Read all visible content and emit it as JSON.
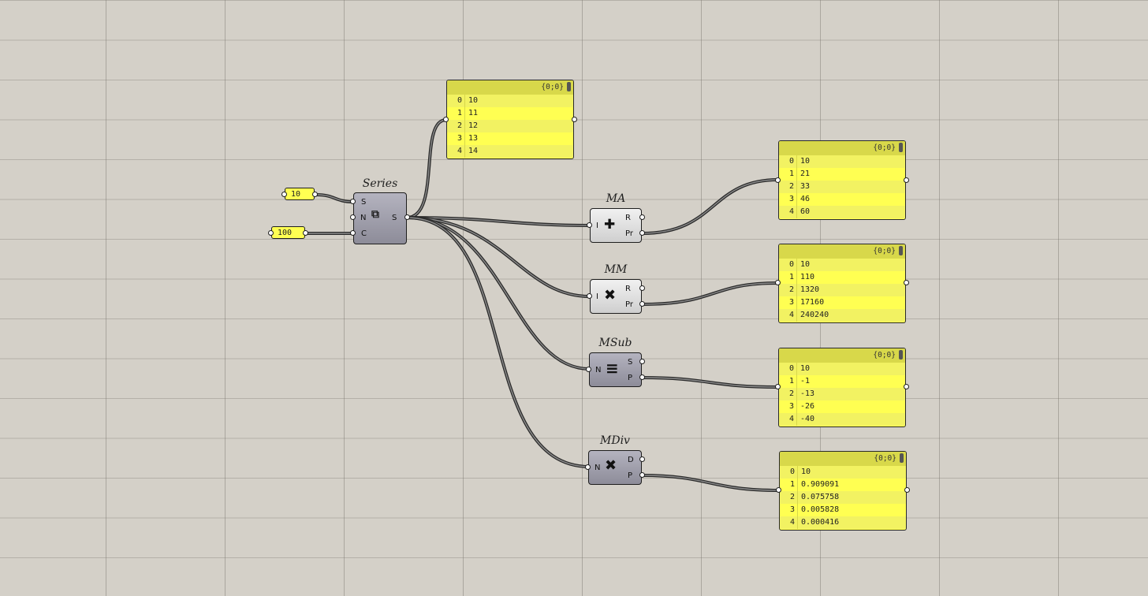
{
  "sliders": [
    {
      "id": "slider-start",
      "value": "10"
    },
    {
      "id": "slider-count",
      "value": "100"
    }
  ],
  "components": {
    "series": {
      "title": "Series",
      "inputs": [
        "S",
        "N",
        "C"
      ],
      "outputs": [
        "S"
      ],
      "icon": "series-icon"
    },
    "ma": {
      "title": "MA",
      "inputs": [
        "I"
      ],
      "outputs": [
        "R",
        "Pr"
      ],
      "icon": "mass-addition-icon"
    },
    "mm": {
      "title": "MM",
      "inputs": [
        "I"
      ],
      "outputs": [
        "R",
        "Pr"
      ],
      "icon": "mass-multiplication-icon"
    },
    "msub": {
      "title": "MSub",
      "inputs": [
        "N"
      ],
      "outputs": [
        "S",
        "P"
      ],
      "icon": "mass-subtraction-icon"
    },
    "mdiv": {
      "title": "MDiv",
      "inputs": [
        "N"
      ],
      "outputs": [
        "D",
        "P"
      ],
      "icon": "mass-division-icon"
    }
  },
  "panels": [
    {
      "id": "panel-series",
      "path": "{0;0}",
      "rows": [
        {
          "i": "0",
          "v": "10"
        },
        {
          "i": "1",
          "v": "11"
        },
        {
          "i": "2",
          "v": "12"
        },
        {
          "i": "3",
          "v": "13"
        },
        {
          "i": "4",
          "v": "14"
        }
      ]
    },
    {
      "id": "panel-ma",
      "path": "{0;0}",
      "rows": [
        {
          "i": "0",
          "v": "10"
        },
        {
          "i": "1",
          "v": "21"
        },
        {
          "i": "2",
          "v": "33"
        },
        {
          "i": "3",
          "v": "46"
        },
        {
          "i": "4",
          "v": "60"
        }
      ]
    },
    {
      "id": "panel-mm",
      "path": "{0;0}",
      "rows": [
        {
          "i": "0",
          "v": "10"
        },
        {
          "i": "1",
          "v": "110"
        },
        {
          "i": "2",
          "v": "1320"
        },
        {
          "i": "3",
          "v": "17160"
        },
        {
          "i": "4",
          "v": "240240"
        }
      ]
    },
    {
      "id": "panel-msub",
      "path": "{0;0}",
      "rows": [
        {
          "i": "0",
          "v": "10"
        },
        {
          "i": "1",
          "v": "-1"
        },
        {
          "i": "2",
          "v": "-13"
        },
        {
          "i": "3",
          "v": "-26"
        },
        {
          "i": "4",
          "v": "-40"
        }
      ]
    },
    {
      "id": "panel-mdiv",
      "path": "{0;0}",
      "rows": [
        {
          "i": "0",
          "v": "10"
        },
        {
          "i": "1",
          "v": "0.909091"
        },
        {
          "i": "2",
          "v": "0.075758"
        },
        {
          "i": "3",
          "v": "0.005828"
        },
        {
          "i": "4",
          "v": "0.000416"
        }
      ]
    }
  ]
}
